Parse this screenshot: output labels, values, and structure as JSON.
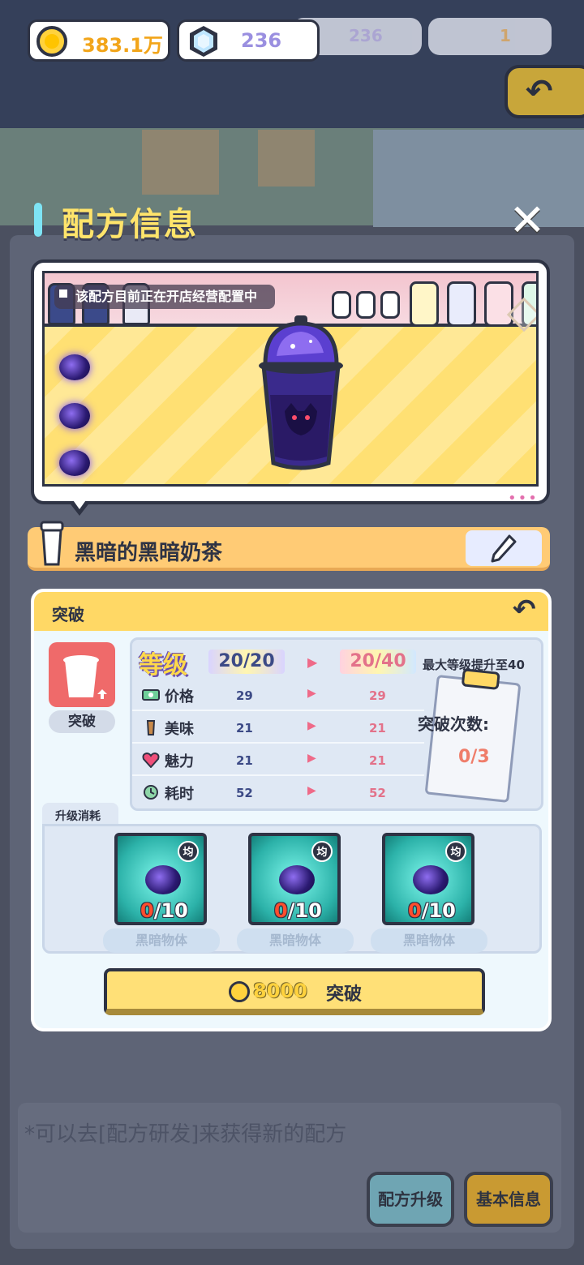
{
  "currency": {
    "coins": "383.1万",
    "gems": "236",
    "ghost_gems": "236",
    "ghost_item": "1"
  },
  "background": {
    "hint": "*可以去[配方研发]来获得新的配方",
    "ghost_btn_left": "配方升级",
    "ghost_btn_right": "基本信息"
  },
  "dialog": {
    "title": "配方信息",
    "status": "该配方目前正在开店经营配置中",
    "recipe_name": "黑暗的黑暗奶茶"
  },
  "breakthrough": {
    "header": "突破",
    "icon_label": "突破",
    "level_label": "等级",
    "level_current": "20/20",
    "level_next": "20/40",
    "max_level_note": "最大等级提升至40",
    "stats": [
      {
        "name": "价格",
        "icon": "money-icon",
        "current": "29",
        "next": "29"
      },
      {
        "name": "美味",
        "icon": "cup-icon",
        "current": "21",
        "next": "21"
      },
      {
        "name": "魅力",
        "icon": "heart-icon",
        "current": "21",
        "next": "21"
      },
      {
        "name": "耗时",
        "icon": "clock-icon",
        "current": "52",
        "next": "52"
      }
    ],
    "count_label": "突破次数:",
    "count_value": "0/3",
    "cost_label": "升级消耗",
    "materials": [
      {
        "name": "黑暗物体",
        "have": "0",
        "need": "/10",
        "badge": "均"
      },
      {
        "name": "黑暗物体",
        "have": "0",
        "need": "/10",
        "badge": "均"
      },
      {
        "name": "黑暗物体",
        "have": "0",
        "need": "/10",
        "badge": "均"
      }
    ],
    "button_cost": "8000",
    "button_label": "突破"
  },
  "colors": {
    "accent_yellow": "#ffd865",
    "title_yellow": "#ffe46b",
    "pink": "#ef6a88",
    "panel": "#eef8fd"
  }
}
